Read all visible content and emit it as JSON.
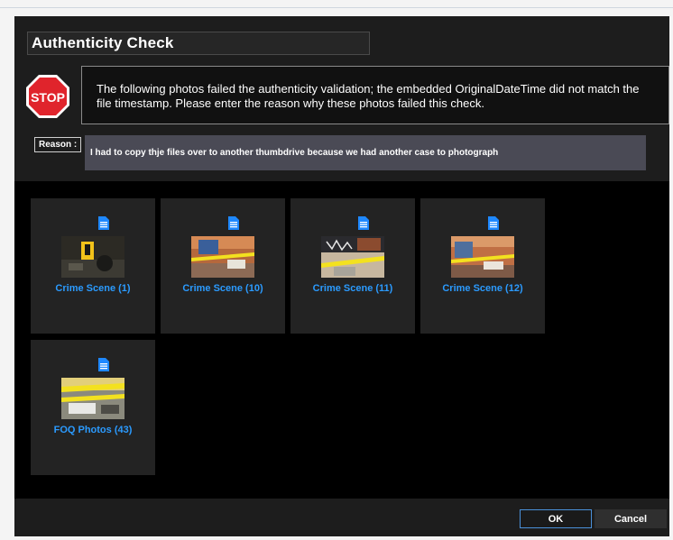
{
  "dialog": {
    "title": "Authenticity Check",
    "stop_text": "STOP",
    "message": "The following photos failed the authenticity validation; the embedded OriginalDateTime did not match the file timestamp. Please enter the reason why these photos failed this check.",
    "reason_label": "Reason :",
    "reason_value": "I had to copy thje files over to another thumbdrive because we had another case to photograph"
  },
  "photos": [
    {
      "label": "Crime Scene (1)",
      "icon": "document-icon"
    },
    {
      "label": "Crime Scene (10)",
      "icon": "document-icon"
    },
    {
      "label": "Crime Scene (11)",
      "icon": "document-icon"
    },
    {
      "label": "Crime Scene (12)",
      "icon": "document-icon"
    },
    {
      "label": "FOQ Photos (43)",
      "icon": "document-icon"
    }
  ],
  "buttons": {
    "ok": "OK",
    "cancel": "Cancel"
  },
  "colors": {
    "dialog_bg": "#1d1d1d",
    "grid_bg": "#000000",
    "tile_bg": "#232323",
    "label_blue": "#2b9bff",
    "stop_red": "#e0242c",
    "ok_border": "#4a90d9"
  }
}
